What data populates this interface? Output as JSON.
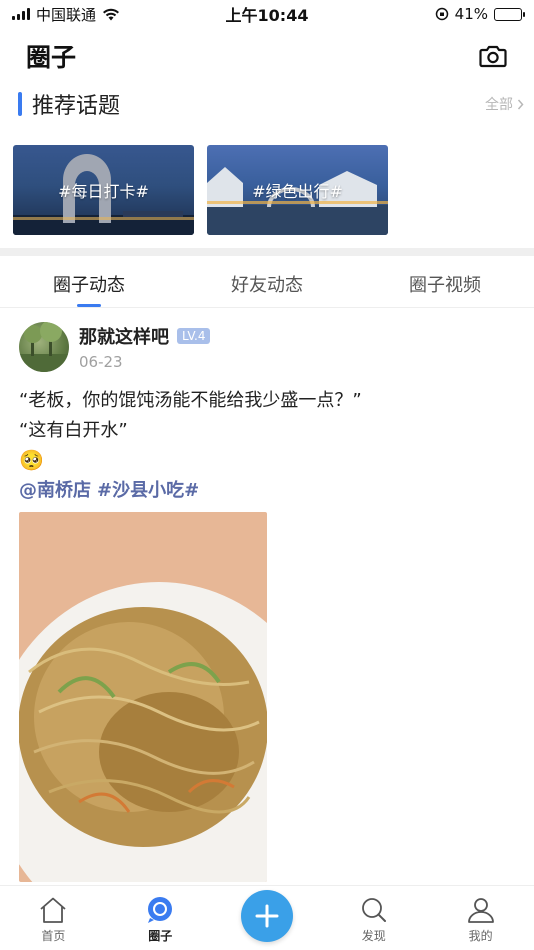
{
  "status_bar": {
    "carrier": "中国联通",
    "time": "上午10:44",
    "battery": "41%",
    "battery_fill": 0.41
  },
  "header": {
    "title": "圈子"
  },
  "recommended": {
    "title": "推荐话题",
    "see_all": "全部",
    "topics": [
      {
        "label": "#每日打卡#"
      },
      {
        "label": "#绿色出行#"
      }
    ]
  },
  "tabs": [
    {
      "label": "圈子动态"
    },
    {
      "label": "好友动态"
    },
    {
      "label": "圈子视频"
    }
  ],
  "post": {
    "author": "那就这样吧",
    "level": "LV.4",
    "date": "06-23",
    "line1": "“老板，你的馄饨汤能不能给我少盛一点？”",
    "line2": "“这有白开水”",
    "emoji": "🥺",
    "mention": "@南桥店",
    "hashtag": "#沙县小吃#"
  },
  "bottom_nav": [
    {
      "label": "首页"
    },
    {
      "label": "圈子"
    },
    {
      "label": ""
    },
    {
      "label": "发现"
    },
    {
      "label": "我的"
    }
  ],
  "colors": {
    "accent": "#3a7bf0",
    "fab": "#3aa0e8",
    "tag": "#5a6aa6"
  }
}
